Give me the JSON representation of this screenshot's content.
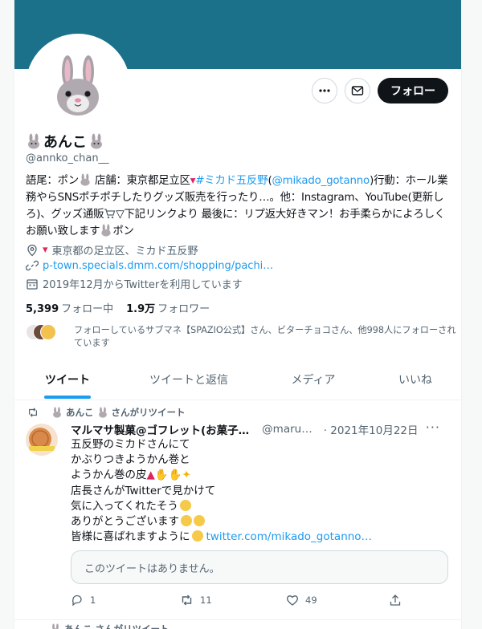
{
  "profile": {
    "display_name": "あんこ",
    "handle": "@annko_chan__",
    "follow_label": "フォロー",
    "bio_part1": "語尾：ポン",
    "bio_part2": " 店舗：東京都足立区",
    "bio_link1": "#ミカド五反野",
    "bio_part3": "(",
    "bio_link2": "@mikado_gotanno",
    "bio_part4": ")行動：ホール業務やらSNSポチポチしたりグッズ販売を行ったり…。他：Instagram、YouTube(更新しろ)、グッズ通販",
    "bio_part5": "▽下記リンクより 最後に：リプ返大好きマン！お手柔らかによろしくお願い致します",
    "bio_part6": "ポン",
    "location": "東京都の足立区、ミカド五反野",
    "website": "p-town.specials.dmm.com/shopping/pachi…",
    "joined": "2019年12月からTwitterを利用しています",
    "following_count": "5,399",
    "following_label": "フォロー中",
    "followers_count": "1.9万",
    "followers_label": "フォロワー",
    "mutuals_text": "フォローしているサブマネ【SPAZIO公式】さん、ビターチョコさん、他998人にフォローされています"
  },
  "tabs": [
    {
      "label": "ツイート"
    },
    {
      "label": "ツイートと返信"
    },
    {
      "label": "メディア"
    },
    {
      "label": "いいね"
    }
  ],
  "tweet": {
    "retweet_by": "あんこ",
    "retweet_suffix": "さんがリツイート",
    "author": "マルマサ製菓@ゴフレット(お菓子…",
    "username": "@maru…",
    "date": "· 2021年10月22日",
    "lines": [
      "五反野のミカドさんにて",
      "かぶりつきようかん巻と",
      "ようかん巻の皮",
      "店長さんがTwitterで見かけて",
      "気に入ってくれたそう",
      "ありがとうございます",
      "皆様に喜ばれますように"
    ],
    "link": "twitter.com/mikado_gotanno…",
    "quote_unavailable": "このツイートはありません。",
    "reply_count": "1",
    "retweet_count": "11",
    "like_count": "49"
  },
  "next_tweet": {
    "retweet_by": "あんこ",
    "retweet_suffix": "さんがリツイート"
  },
  "colors": {
    "banner": "#1a7189",
    "accent": "#1d9bf0",
    "follow_button": "#0f1419"
  },
  "icons": [
    "rabbit-icon",
    "more-icon",
    "mail-icon",
    "location-icon",
    "pin-icon",
    "link-icon",
    "calendar-icon",
    "retweet-icon",
    "reply-icon",
    "like-icon",
    "share-icon",
    "cart-icon"
  ]
}
